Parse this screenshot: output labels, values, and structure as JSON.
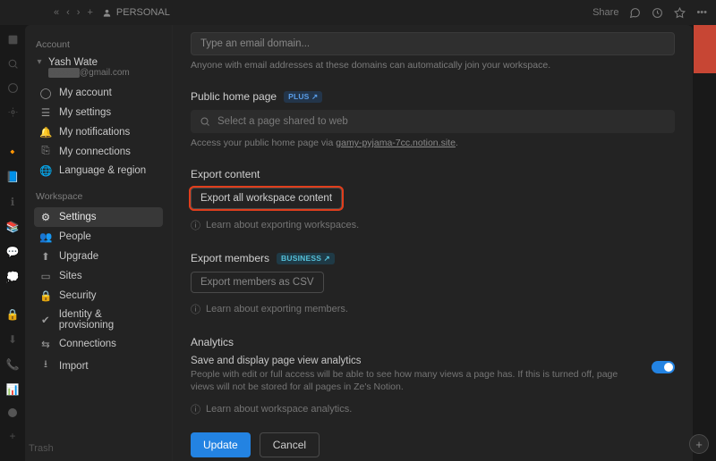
{
  "topbar": {
    "breadcrumb_icon": "person-icon",
    "breadcrumb_label": "PERSONAL",
    "share_label": "Share"
  },
  "sidebar": {
    "account_header": "Account",
    "user": {
      "name": "Yash Wate",
      "email_suffix": "@gmail.com"
    },
    "account_items": [
      {
        "icon": "user-circle-icon",
        "label": "My account"
      },
      {
        "icon": "sliders-icon",
        "label": "My settings"
      },
      {
        "icon": "bell-icon",
        "label": "My notifications"
      },
      {
        "icon": "link-icon",
        "label": "My connections"
      },
      {
        "icon": "globe-icon",
        "label": "Language & region"
      }
    ],
    "workspace_header": "Workspace",
    "workspace_items": [
      {
        "icon": "gear-icon",
        "label": "Settings",
        "selected": true
      },
      {
        "icon": "people-icon",
        "label": "People"
      },
      {
        "icon": "arrow-up-circle-icon",
        "label": "Upgrade"
      },
      {
        "icon": "browser-icon",
        "label": "Sites"
      },
      {
        "icon": "lock-icon",
        "label": "Security"
      },
      {
        "icon": "shield-check-icon",
        "label": "Identity & provisioning"
      },
      {
        "icon": "plug-icon",
        "label": "Connections"
      },
      {
        "icon": "download-icon",
        "label": "Import"
      }
    ]
  },
  "content": {
    "email_domain": {
      "placeholder": "Type an email domain...",
      "hint": "Anyone with email addresses at these domains can automatically join your workspace."
    },
    "public_home": {
      "title": "Public home page",
      "pill": "PLUS ↗",
      "search_placeholder": "Select a page shared to web",
      "hint_prefix": "Access your public home page via ",
      "hint_link": "gamy-pyjama-7cc.notion.site"
    },
    "export_content": {
      "title": "Export content",
      "button": "Export all workspace content",
      "learn": "Learn about exporting workspaces."
    },
    "export_members": {
      "title": "Export members",
      "pill": "BUSINESS ↗",
      "button": "Export members as CSV",
      "learn": "Learn about exporting members."
    },
    "analytics": {
      "title": "Analytics",
      "sub_title": "Save and display page view analytics",
      "desc": "People with edit or full access will be able to see how many views a page has. If this is turned off, page views will not be stored for all pages in Ze's Notion.",
      "learn": "Learn about workspace analytics."
    },
    "footer": {
      "update": "Update",
      "cancel": "Cancel"
    }
  },
  "misc": {
    "trash": "Trash"
  }
}
